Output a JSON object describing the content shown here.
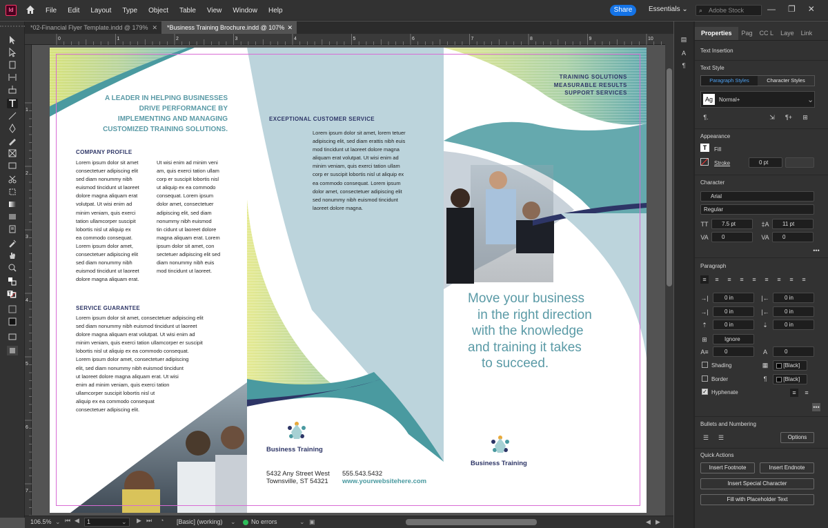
{
  "app": {
    "menu": [
      "File",
      "Edit",
      "Layout",
      "Type",
      "Object",
      "Table",
      "View",
      "Window",
      "Help"
    ],
    "share_label": "Share",
    "workspace": "Essentials",
    "search_placeholder": "Adobe Stock"
  },
  "tabs": [
    {
      "label": "*02-Financial Flyer Template.indd @ 179%",
      "active": false
    },
    {
      "label": "*Business Training Brochure.indd @ 107%",
      "active": true
    }
  ],
  "ruler": {
    "h_ticks": [
      "0",
      "1",
      "2",
      "3",
      "4",
      "5",
      "6",
      "7",
      "8",
      "9",
      "10"
    ],
    "v_ticks": [
      "1",
      "2",
      "3",
      "4",
      "5",
      "6",
      "7"
    ]
  },
  "document": {
    "panel1": {
      "headline": [
        "A LEADER IN HELPING BUSINESSES",
        "DRIVE PERFORMANCE BY",
        "IMPLEMENTING AND MANAGING",
        "CUSTOMIZED TRAINING SOLUTIONS."
      ],
      "profile_heading": "COMPANY PROFILE",
      "profile_col1": [
        "Lorem ipsum dolor sit amet",
        "consectetuer adipiscing elit",
        "sed diam nonummy nibh",
        "euismod tincidunt ut laoreet",
        "dolore magna aliquam erat",
        "volutpat. Ut wisi enim ad",
        "minim veniam, quis exerci",
        "tation ullamcorper suscipit",
        "lobortis nisl ut aliquip ex",
        "ea commodo consequat.",
        "Lorem ipsum dolor amet,",
        "consectetuer adipiscing elit",
        "sed diam nonummy nibh",
        "euismod tincidunt ut laoreet",
        "dolore magna aliquam erat."
      ],
      "profile_col2": [
        "Ut wisi enim ad minim veni",
        "am, quis exerci tation ullam",
        "corp er suscipit lobortis nisl",
        "ut aliquip ex ea commodo",
        "consequat. Lorem ipsum",
        "dolor amet, consectetuer",
        "adipiscing elit, sed diam",
        "nonummy nibh euismod",
        "tin cidunt ut laoreet dolore",
        "magna aliquam erat. Lorem",
        "ipsum dolor sit amet, con",
        "sectetuer adipiscing elit sed",
        "diam nonummy nibh euis",
        "mod tincidunt ut laoreet."
      ],
      "guarantee_heading": "SERVICE GUARANTEE",
      "guarantee_lines": [
        "Lorem ipsum dolor sit amet, consectetuer adipiscing elit",
        "sed diam nonummy nibh euismod tincidunt ut laoreet",
        "dolore magna aliquam erat volutpat. Ut wisi enim ad",
        "minim veniam, quis exerci tation ullamcorper er suscipit",
        "lobortis nisl ut aliquip ex ea commodo consequat.",
        "Lorem ipsum dolor amet, consectetuer adipiscing",
        "elit, sed diam nonummy nibh euismod tincidunt",
        "ut laoreet dolore magna aliquam erat. Ut wisi",
        "enim ad minim veniam, quis exerci tation",
        "ullamcorper suscipit lobortis nisl ut",
        "aliquip ex ea commodo consequat",
        "consectetuer adipiscing elit."
      ]
    },
    "panel2": {
      "heading": "EXCEPTIONAL CUSTOMER SERVICE",
      "body": [
        "Lorem ipsum dolor sit amet, lorem tetuer",
        "adipiscing elit, sed diam erattis nibh euis",
        "mod tincidunt ut laoreet dolore magna",
        "aliquam erat volutpat. Ut wisi enim ad",
        "minim veniam, quis exerci tation ullam",
        "corp er suscipit lobortis nisl ut aliquip ex",
        "ea commodo consequat. Lorem ipsum",
        "dolor amet, consectetuer adipiscing elit",
        "sed nonummy nibh euismod tincidunt",
        "laoreet dolore magna."
      ],
      "company": "Business Training",
      "address_line1": "5432 Any Street West",
      "address_line2": "Townsville, ST 54321",
      "phone": "555.543.5432",
      "website": "www.yourwebsitehere.com"
    },
    "panel3": {
      "services": [
        "TRAINING SOLUTIONS",
        "MEASURABLE RESULTS",
        "SUPPORT SERVICES"
      ],
      "tagline": [
        "Move your business",
        "in the right direction",
        "with the knowledge",
        "and training it takes",
        "to succeed."
      ],
      "company": "Business Training"
    },
    "colors": {
      "teal": "#4a9aa0",
      "navy": "#2d3566",
      "pale_blue": "#bcd4dc",
      "headline": "#5a9aa6"
    }
  },
  "status": {
    "zoom": "106.5%",
    "page": "1",
    "style": "[Basic] (working)",
    "errors": "No errors"
  },
  "properties": {
    "tabs": [
      "Properties",
      "Pag",
      "CC L",
      "Laye",
      "Link"
    ],
    "text_insertion": "Text Insertion",
    "text_style": "Text Style",
    "paragraph_styles": "Paragraph Styles",
    "character_styles": "Character Styles",
    "style_preview": "Ag",
    "style_name": "Normal+",
    "appearance": "Appearance",
    "fill": "Fill",
    "stroke": "Stroke",
    "stroke_value": "0 pt",
    "character": "Character",
    "font": "Arial",
    "font_style": "Regular",
    "font_size": "7.5 pt",
    "leading": "11 pt",
    "kerning": "0",
    "tracking": "0",
    "paragraph": "Paragraph",
    "indent_left": "0 in",
    "indent_right": "0 in",
    "first_indent": "0 in",
    "last_indent": "0 in",
    "space_before": "0 in",
    "space_after": "0 in",
    "align_grid": "Ignore",
    "drop_lines": "0",
    "drop_chars": "0",
    "shading": "Shading",
    "border": "Border",
    "shading_color": "[Black]",
    "border_color": "[Black]",
    "hyphenate": "Hyphenate",
    "bullets": "Bullets and Numbering",
    "options": "Options",
    "quick_actions": "Quick Actions",
    "insert_footnote": "Insert Footnote",
    "insert_endnote": "Insert Endnote",
    "insert_special": "Insert Special Character",
    "fill_placeholder": "Fill with Placeholder Text"
  }
}
